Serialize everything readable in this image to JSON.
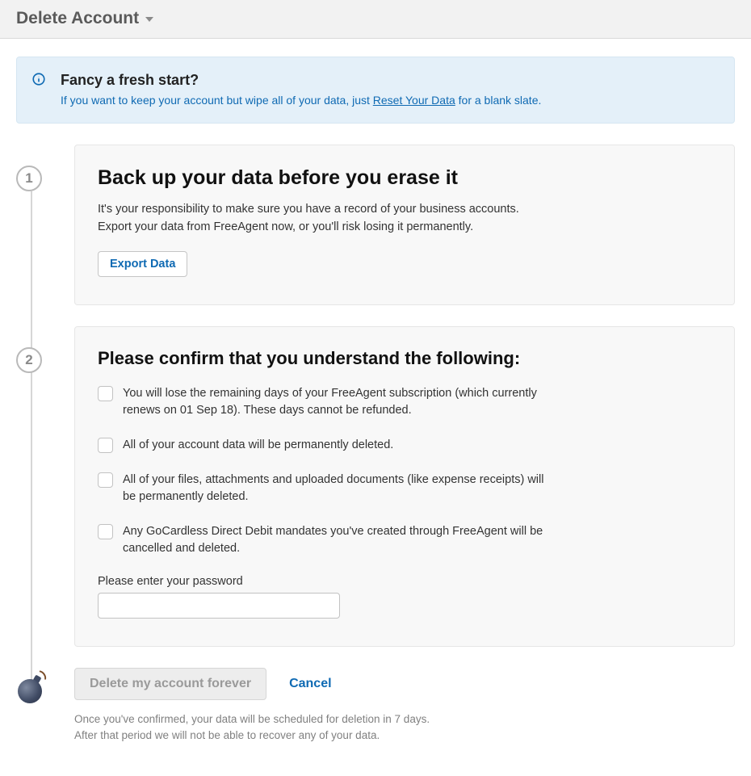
{
  "header": {
    "title": "Delete Account"
  },
  "banner": {
    "title": "Fancy a fresh start?",
    "text_prefix": "If you want to keep your account but wipe all of your data, just ",
    "link_label": "Reset Your Data",
    "text_suffix": " for a blank slate."
  },
  "step1": {
    "number": "1",
    "title": "Back up your data before you erase it",
    "text_line1": "It's your responsibility to make sure you have a record of your business accounts.",
    "text_line2": "Export your data from FreeAgent now, or you'll risk losing it permanently.",
    "export_label": "Export Data"
  },
  "step2": {
    "number": "2",
    "title": "Please confirm that you understand the following:",
    "items": [
      "You will lose the remaining days of your FreeAgent subscription (which currently renews on 01 Sep 18). These days cannot be refunded.",
      "All of your account data will be permanently deleted.",
      "All of your files, attachments and uploaded documents (like expense receipts) will be permanently deleted.",
      "Any GoCardless Direct Debit mandates you've created through FreeAgent will be cancelled and deleted."
    ],
    "password_label": "Please enter your password",
    "password_value": ""
  },
  "actions": {
    "delete_label": "Delete my account forever",
    "cancel_label": "Cancel",
    "note_line1": "Once you've confirmed, your data will be scheduled for deletion in 7 days.",
    "note_line2": "After that period we will not be able to recover any of your data."
  }
}
